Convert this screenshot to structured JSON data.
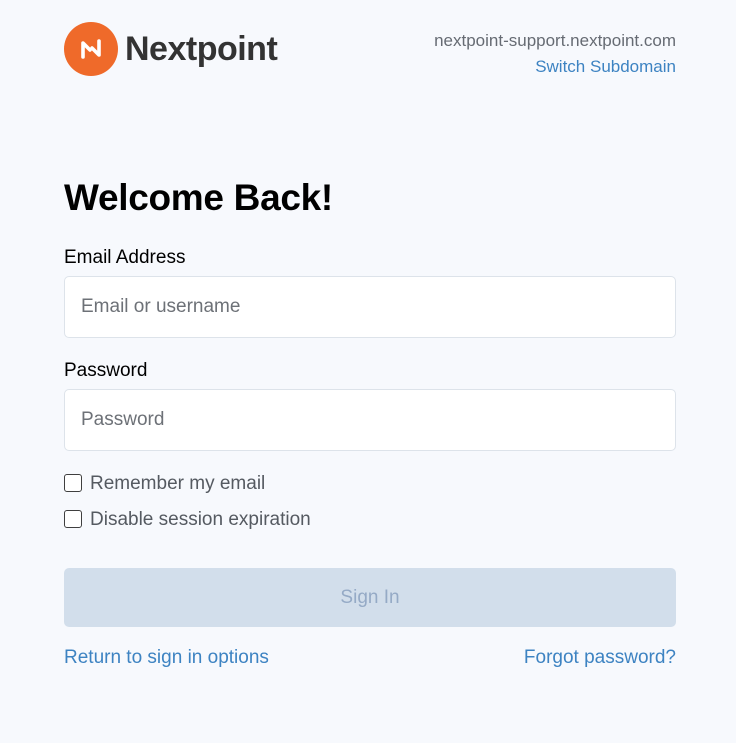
{
  "brand": {
    "name": "Nextpoint",
    "logo_icon": "nextpoint-n-logo-icon",
    "logo_color": "#ef6a2a"
  },
  "subdomain": {
    "host": "nextpoint-support.nextpoint.com",
    "switch_label": "Switch Subdomain"
  },
  "form": {
    "title": "Welcome Back!",
    "email_label": "Email Address",
    "email_placeholder": "Email or username",
    "email_value": "",
    "password_label": "Password",
    "password_placeholder": "Password",
    "password_value": "",
    "remember_label": "Remember my email",
    "remember_checked": false,
    "expire_label": "Disable session expiration",
    "expire_checked": false,
    "signin_label": "Sign In",
    "signin_enabled": false
  },
  "links": {
    "return_label": "Return to sign in options",
    "forgot_label": "Forgot password?"
  },
  "colors": {
    "accent": "#3d83c2",
    "background": "#f7f9fd",
    "button_disabled": "#d2deeb"
  }
}
